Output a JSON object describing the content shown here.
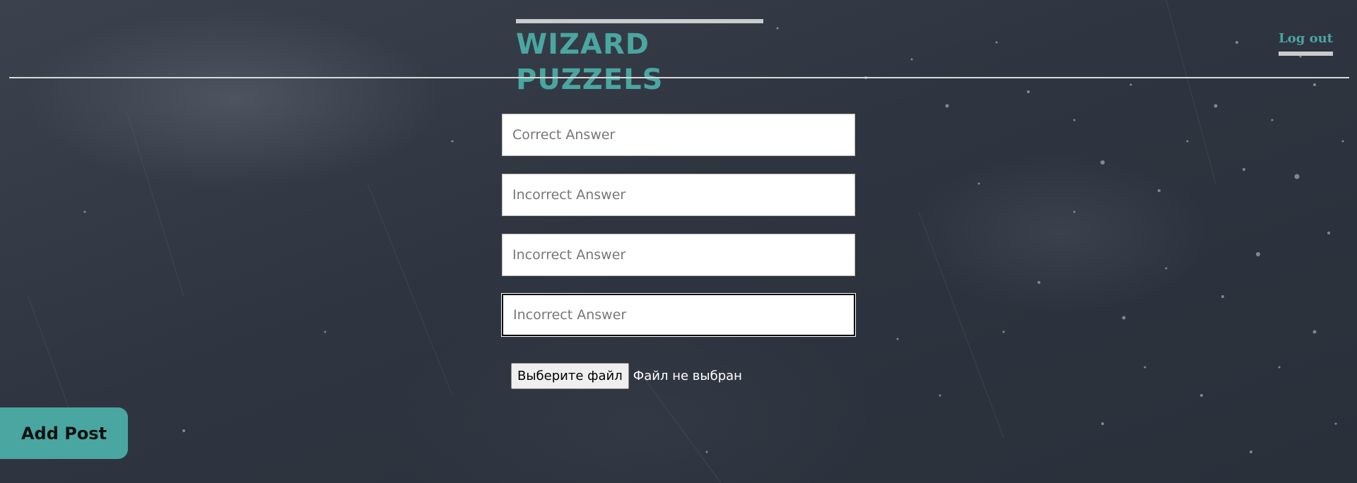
{
  "header": {
    "title": "WIZARD PUZZELS",
    "logout_label": "Log out"
  },
  "form": {
    "correct_answer": {
      "placeholder": "Correct Answer",
      "value": ""
    },
    "incorrect_answers": [
      {
        "placeholder": "Incorrect Answer",
        "value": ""
      },
      {
        "placeholder": "Incorrect Answer",
        "value": ""
      },
      {
        "placeholder": "Incorrect Answer",
        "value": ""
      }
    ],
    "file_input": {
      "button_label": "Выберите файл",
      "status": "Файл не выбран"
    }
  },
  "actions": {
    "add_post_label": "Add Post"
  },
  "colors": {
    "accent": "#4aa6a0",
    "background": "#2f3540",
    "rule": "#c9cbce"
  }
}
